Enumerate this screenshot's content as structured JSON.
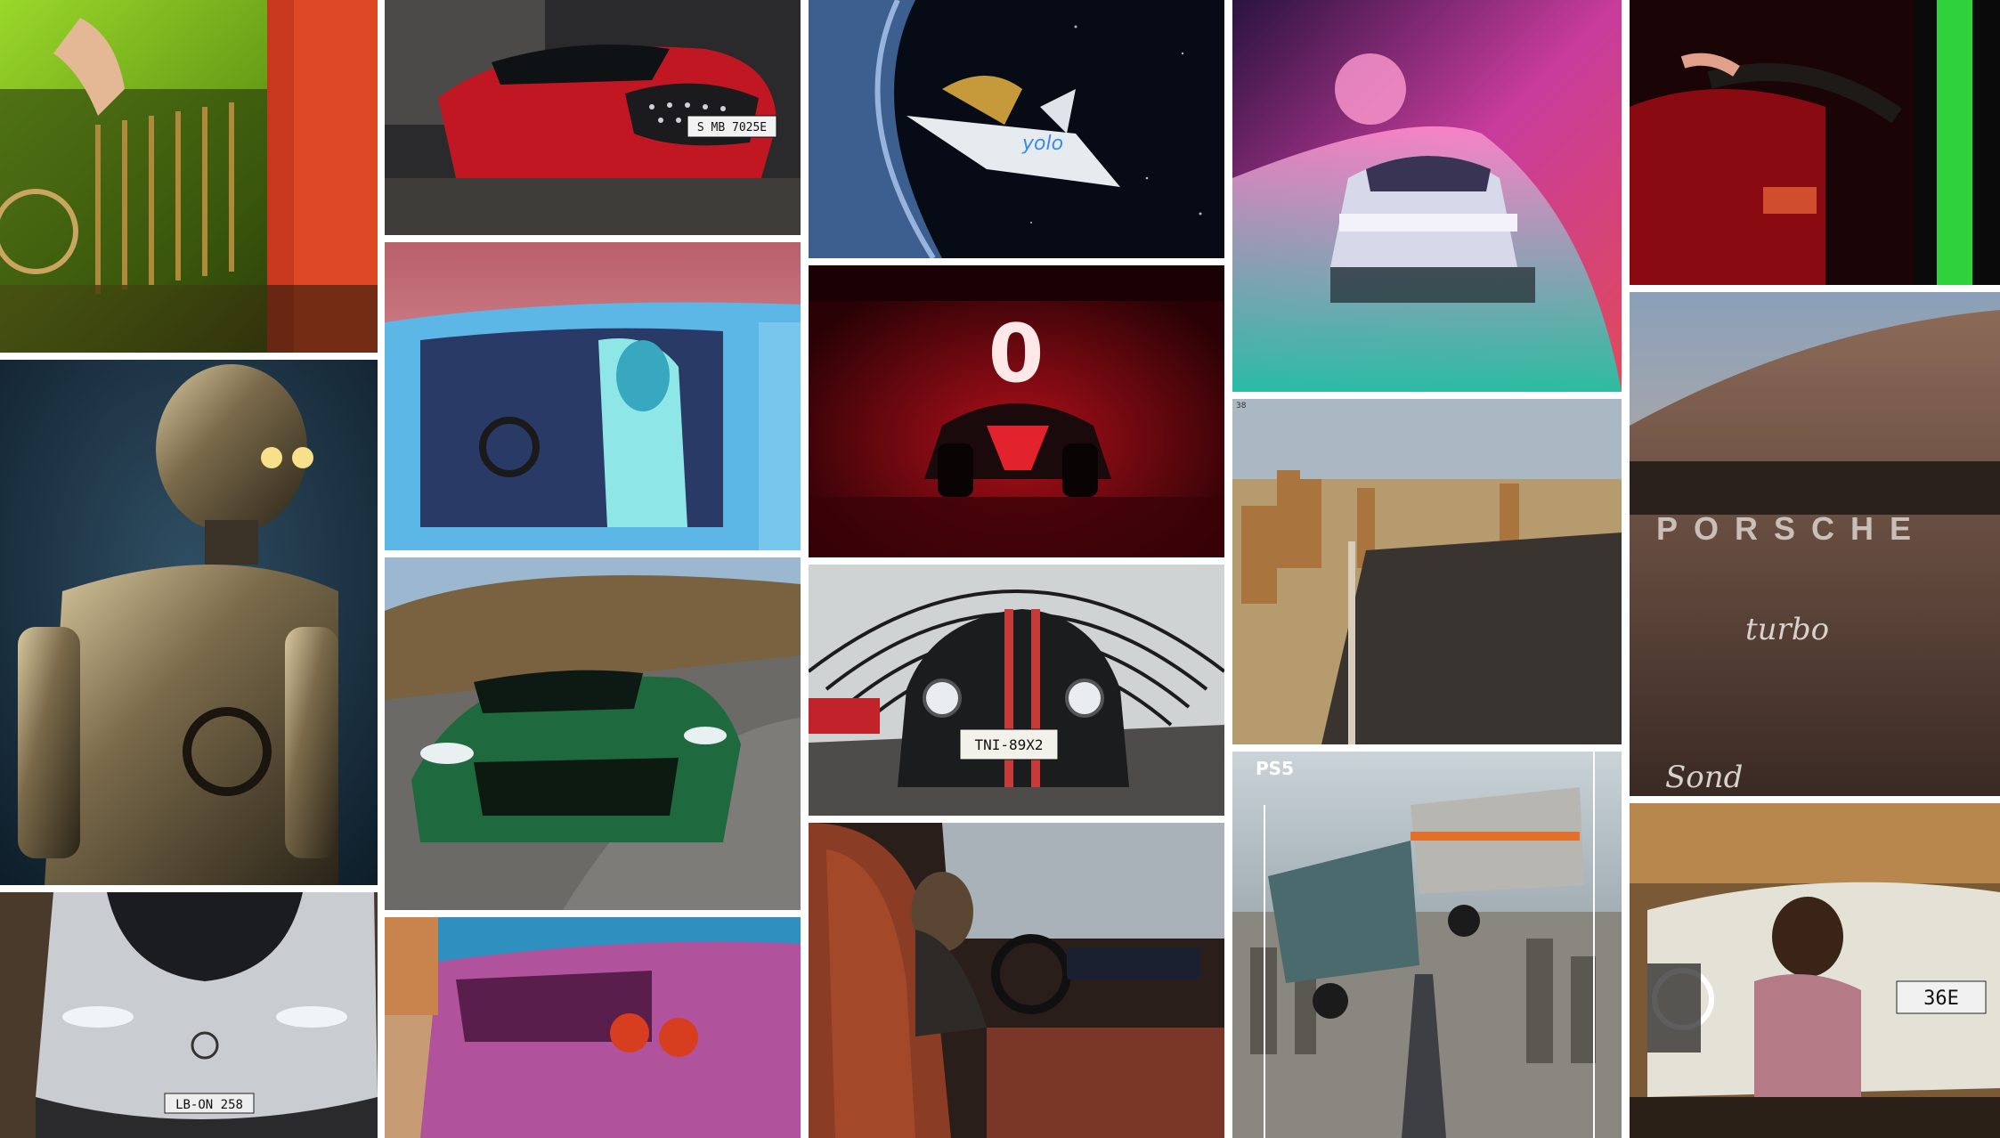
{
  "tiles": [
    {
      "id": "green-g-class",
      "alt": "Green Mercedes G-Class grille"
    },
    {
      "id": "red-mercedes-city",
      "alt": "Red Mercedes sedan"
    },
    {
      "id": "space-shuttle",
      "alt": "Space shuttle over earth"
    },
    {
      "id": "eqs-neon-road",
      "alt": "Mercedes EQS on neon road"
    },
    {
      "id": "red-interior-driver",
      "alt": "Driver in red-lit interior"
    },
    {
      "id": "c3po-robot",
      "alt": "Golden robot"
    },
    {
      "id": "blue-car-woman",
      "alt": "Woman in blue car"
    },
    {
      "id": "formula-e-car",
      "alt": "Formula E race car"
    },
    {
      "id": "desert-ruins",
      "alt": "Desert ruins bridge"
    },
    {
      "id": "porsche-turbo-detail",
      "alt": "Porsche rear detail"
    },
    {
      "id": "aston-martin-green",
      "alt": "Green Aston Martin on road"
    },
    {
      "id": "mini-tunnel",
      "alt": "Mini in tunnel"
    },
    {
      "id": "amg-one-silver",
      "alt": "Silver Mercedes hypercar"
    },
    {
      "id": "pink-lamborghini",
      "alt": "Pink sports car rear"
    },
    {
      "id": "bmw-interior-driver",
      "alt": "Driver in BMW interior"
    },
    {
      "id": "ps5-flying-truck",
      "alt": "Flying truck above city"
    },
    {
      "id": "hyundai-person",
      "alt": "Person with small car"
    }
  ],
  "text": {
    "red_plate": "S MB 7025E",
    "mini_plate": "TNI-89X2",
    "amg_plate": "LB-ON 258",
    "hyundai_plate": "36E",
    "porsche_badge": "PORSCHE",
    "porsche_model": "turbo",
    "porsche_sonder": "Sond",
    "shuttle_text": "yolo",
    "formula_number": "0",
    "ps5_logo": "PS5",
    "corner_mark": "38"
  }
}
